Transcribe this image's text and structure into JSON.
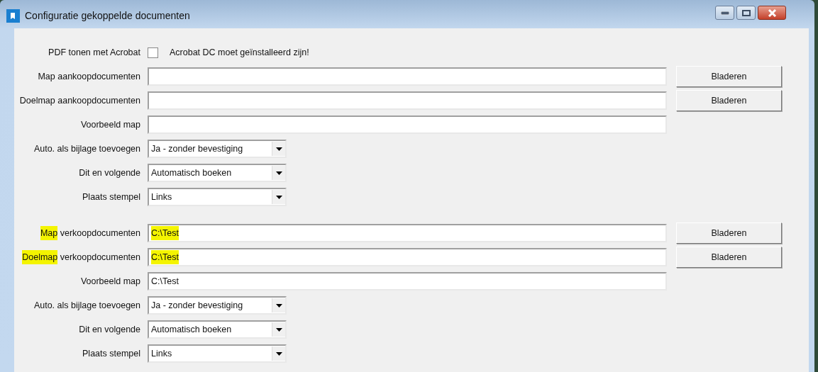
{
  "window": {
    "title": "Configuratie gekoppelde documenten"
  },
  "pdf_option": {
    "label": "PDF tonen met Acrobat",
    "checked": false,
    "note": "Acrobat DC moet geïnstalleerd zijn!"
  },
  "sections": [
    {
      "rows": [
        {
          "kind": "text_field",
          "label": [
            {
              "text": "Map aankoopdocumenten",
              "highlighted": false
            }
          ],
          "button": "Bladeren"
        },
        {
          "kind": "text_field",
          "label": [
            {
              "text": "Doelmap aankoopdocumenten",
              "highlighted": false
            }
          ],
          "button": "Bladeren"
        },
        {
          "kind": "text_field",
          "label": [
            {
              "text": "Voorbeeld map",
              "highlighted": false
            }
          ]
        },
        {
          "kind": "dropdown",
          "label": [
            {
              "text": "Auto. als bijlage toevoegen",
              "highlighted": false
            }
          ],
          "value": "Ja - zonder bevestiging"
        },
        {
          "kind": "dropdown",
          "label": [
            {
              "text": "Dit en volgende",
              "highlighted": false
            }
          ],
          "value": "Automatisch boeken"
        },
        {
          "kind": "dropdown",
          "label": [
            {
              "text": "Plaats stempel",
              "highlighted": false
            }
          ],
          "value": "Links"
        }
      ]
    },
    {
      "rows": [
        {
          "kind": "text_field",
          "label": [
            {
              "text": "Map",
              "highlighted": true
            },
            {
              "text": " verkoopdocumenten",
              "highlighted": false
            }
          ],
          "value": "C:\\Test",
          "value_highlighted": true,
          "button": "Bladeren"
        },
        {
          "kind": "text_field",
          "label": [
            {
              "text": "Doelmap",
              "highlighted": true
            },
            {
              "text": " verkoopdocumenten",
              "highlighted": false
            }
          ],
          "value": "C:\\Test",
          "value_highlighted": true,
          "button": "Bladeren"
        },
        {
          "kind": "text_field",
          "label": [
            {
              "text": "Voorbeeld map",
              "highlighted": false
            }
          ],
          "value": "C:\\Test",
          "value_highlighted": false
        },
        {
          "kind": "dropdown",
          "label": [
            {
              "text": "Auto. als bijlage toevoegen",
              "highlighted": false
            }
          ],
          "value": "Ja - zonder bevestiging"
        },
        {
          "kind": "dropdown",
          "label": [
            {
              "text": "Dit en volgende",
              "highlighted": false
            }
          ],
          "value": "Automatisch boeken"
        },
        {
          "kind": "dropdown",
          "label": [
            {
              "text": "Plaats stempel",
              "highlighted": false
            }
          ],
          "value": "Links"
        }
      ]
    }
  ]
}
